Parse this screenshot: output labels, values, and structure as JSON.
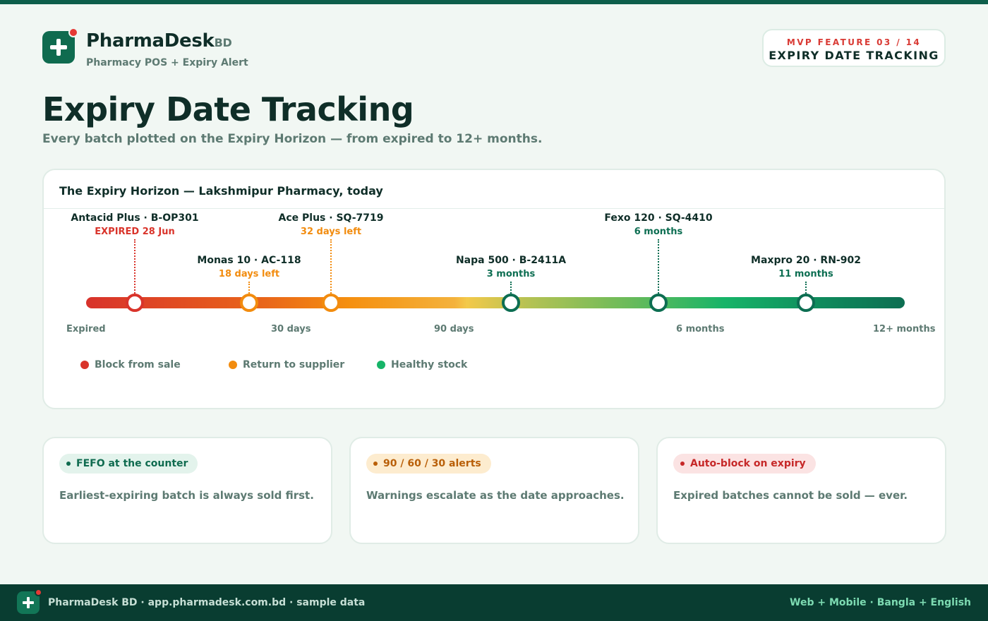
{
  "brand": {
    "name": "PharmaDesk",
    "suffix": "BD",
    "tagline": "Pharmacy POS + Expiry Alert"
  },
  "feature_badge": {
    "kicker": "MVP FEATURE 03 / 14",
    "title": "EXPIRY DATE TRACKING"
  },
  "page": {
    "title": "Expiry Date Tracking",
    "subtitle": "Every batch plotted on the Expiry Horizon — from expired to 12+ months."
  },
  "horizon": {
    "title": "The Expiry Horizon — Lakshmipur Pharmacy, today",
    "scale_labels": [
      "Expired",
      "30 days",
      "90 days",
      "6 months",
      "12+ months"
    ],
    "batches": [
      {
        "name": "Antacid Plus · B-OP301",
        "status": "EXPIRED 28 Jun",
        "zone": "block",
        "color": "#d9342b"
      },
      {
        "name": "Monas 10 · AC-118",
        "status": "18 days left",
        "zone": "return",
        "color": "#f28c0f"
      },
      {
        "name": "Ace Plus · SQ-7719",
        "status": "32 days left",
        "zone": "return",
        "color": "#f28c0f"
      },
      {
        "name": "Napa 500 · B-2411A",
        "status": "3 months",
        "zone": "healthy",
        "color": "#0d6e52"
      },
      {
        "name": "Fexo 120 · SQ-4410",
        "status": "6 months",
        "zone": "healthy",
        "color": "#0d6e52"
      },
      {
        "name": "Maxpro 20 · RN-902",
        "status": "11 months",
        "zone": "healthy",
        "color": "#0d6e52"
      }
    ],
    "legend": [
      {
        "label": "Block from sale",
        "color": "#d9342b"
      },
      {
        "label": "Return to supplier",
        "color": "#f28c0f"
      },
      {
        "label": "Healthy stock",
        "color": "#16b468"
      }
    ]
  },
  "features": [
    {
      "pill": "FEFO at the counter",
      "desc": "Earliest-expiring batch is always sold first.",
      "pill_bg": "#e3f3ec",
      "pill_fg": "#0f6b4f"
    },
    {
      "pill": "90 / 60 / 30 alerts",
      "desc": "Warnings escalate as the date approaches.",
      "pill_bg": "#fdeccf",
      "pill_fg": "#b95f08"
    },
    {
      "pill": "Auto-block on expiry",
      "desc": "Expired batches cannot be sold — ever.",
      "pill_bg": "#fbe3e3",
      "pill_fg": "#c62828"
    }
  ],
  "footer": {
    "left": "PharmaDesk BD · app.pharmadesk.com.bd · sample data",
    "right": "Web + Mobile · Bangla + English"
  }
}
